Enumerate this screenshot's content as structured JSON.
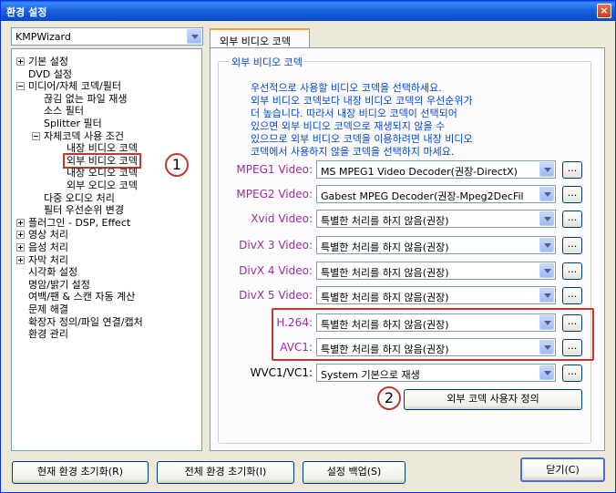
{
  "window": {
    "title": "환경 설정",
    "close_label": "×"
  },
  "skin_select": {
    "value": "KMPWizard"
  },
  "tree": {
    "items": [
      {
        "label": "기본 설정",
        "level": 0,
        "expander": "plus"
      },
      {
        "label": "DVD 설정",
        "level": 0,
        "expander": "none"
      },
      {
        "label": "미디어/자체 코덱/필터",
        "level": 0,
        "expander": "minus"
      },
      {
        "label": "끊김 없는 파일 재생",
        "level": 1,
        "expander": "none"
      },
      {
        "label": "소스 필터",
        "level": 1,
        "expander": "none"
      },
      {
        "label": "Splitter 필터",
        "level": 1,
        "expander": "none"
      },
      {
        "label": "자체코덱 사용 조건",
        "level": 1,
        "expander": "minus"
      },
      {
        "label": "내장 비디오 코덱",
        "level": 2,
        "expander": "none"
      },
      {
        "label": "외부 비디오 코덱",
        "level": 2,
        "expander": "none",
        "selected": true
      },
      {
        "label": "내장 오디오 코덱",
        "level": 2,
        "expander": "none"
      },
      {
        "label": "외부 오디오 코덱",
        "level": 2,
        "expander": "none"
      },
      {
        "label": "다중 오디오 처리",
        "level": 1,
        "expander": "none"
      },
      {
        "label": "필터 우선순위 변경",
        "level": 1,
        "expander": "none"
      },
      {
        "label": "플러그인 - DSP, Effect",
        "level": 0,
        "expander": "plus"
      },
      {
        "label": "영상 처리",
        "level": 0,
        "expander": "plus"
      },
      {
        "label": "음성 처리",
        "level": 0,
        "expander": "plus"
      },
      {
        "label": "자막 처리",
        "level": 0,
        "expander": "plus"
      },
      {
        "label": "시각화 설정",
        "level": 0,
        "expander": "none"
      },
      {
        "label": "명암/밝기 설정",
        "level": 0,
        "expander": "none"
      },
      {
        "label": "여백/팬 & 스캔 자동 계산",
        "level": 0,
        "expander": "none"
      },
      {
        "label": "문제 해결",
        "level": 0,
        "expander": "none"
      },
      {
        "label": "확장자 정의/파일 연결/캡처",
        "level": 0,
        "expander": "none"
      },
      {
        "label": "환경 관리",
        "level": 0,
        "expander": "none"
      }
    ]
  },
  "callouts": {
    "one": "1",
    "two": "2"
  },
  "tab": {
    "label": "외부 비디오 코덱"
  },
  "group": {
    "title": "외부 비디오 코덱",
    "description": [
      "우선적으로 사용할 비디오 코덱을 선택하세요.",
      "외부 비디오 코덱보다 내장 비디오 코덱의 우선순위가",
      "더 높습니다. 따라서 내장 비디오 코덱이 선택되어",
      "있으면 외부 비디오 코덱으로 재생되지 않을 수",
      "있으므로 외부 비디오 코덱을 이용하려면 내장 비디오",
      "코덱에서 사용하지 않을 코덱을 선택하지 마세요."
    ]
  },
  "codecs": [
    {
      "label": "MPEG1 Video:",
      "value": "MS MPEG1 Video Decoder(권장-DirectX)",
      "color": "purple"
    },
    {
      "label": "MPEG2 Video:",
      "value": "Gabest MPEG Decoder(권장-Mpeg2DecFil",
      "color": "purple"
    },
    {
      "label": "Xvid Video:",
      "value": "특별한 처리를 하지 않음(권장)",
      "color": "purple"
    },
    {
      "label": "DivX 3 Video:",
      "value": "특별한 처리를 하지 않음(권장)",
      "color": "purple"
    },
    {
      "label": "DivX 4 Video:",
      "value": "특별한 처리를 하지 않음(권장)",
      "color": "purple"
    },
    {
      "label": "DivX 5 Video:",
      "value": "특별한 처리를 하지 않음(권장)",
      "color": "purple"
    },
    {
      "label": "H.264:",
      "value": "특별한 처리를 하지 않음(권장)",
      "color": "purple"
    },
    {
      "label": "AVC1:",
      "value": "특별한 처리를 하지 않음(권장)",
      "color": "purple"
    },
    {
      "label": "WVC1/VC1:",
      "value": "System 기본으로 재생",
      "color": "dark"
    }
  ],
  "dots_label": "...",
  "custom_codec_button": "외부 코덱 사용자 정의",
  "footer": {
    "reset_current": "현재 환경 초기화(R)",
    "reset_all": "전체 환경 초기화(I)",
    "backup": "설정 백업(S)",
    "close": "닫기(C)"
  },
  "colors": {
    "purple_label": "#a02ba0",
    "blue_text": "#0046d5",
    "highlight_red": "#c0392b"
  }
}
